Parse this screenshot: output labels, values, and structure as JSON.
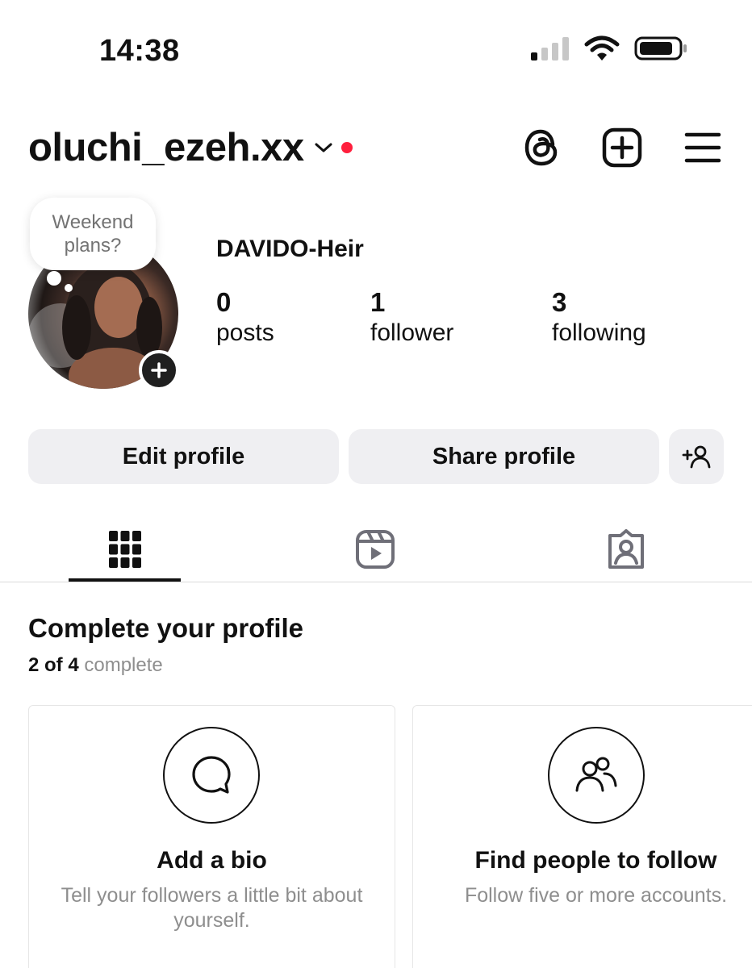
{
  "status_bar": {
    "time": "14:38"
  },
  "header": {
    "username": "oluchi_ezeh.xx"
  },
  "profile": {
    "note": "Weekend plans?",
    "display_name": "DAVIDO-Heir",
    "stats": [
      {
        "count": "0",
        "label": "posts"
      },
      {
        "count": "1",
        "label": "follower"
      },
      {
        "count": "3",
        "label": "following"
      }
    ]
  },
  "actions": {
    "edit": "Edit profile",
    "share": "Share profile"
  },
  "tabs": [
    "grid-icon",
    "reels-icon",
    "tagged-icon"
  ],
  "complete_profile": {
    "title": "Complete your profile",
    "progress_done": "2 of 4",
    "progress_suffix": "complete",
    "cards": [
      {
        "title": "Add a bio",
        "description": "Tell your followers a little bit about yourself.",
        "icon": "speech-bubble-icon"
      },
      {
        "title": "Find people to follow",
        "description": "Follow five or more accounts.",
        "icon": "people-icon"
      }
    ]
  },
  "colors": {
    "accent_red": "#ff1f3d",
    "button_bg": "#efeff2",
    "muted_text": "#8e8e8e"
  }
}
